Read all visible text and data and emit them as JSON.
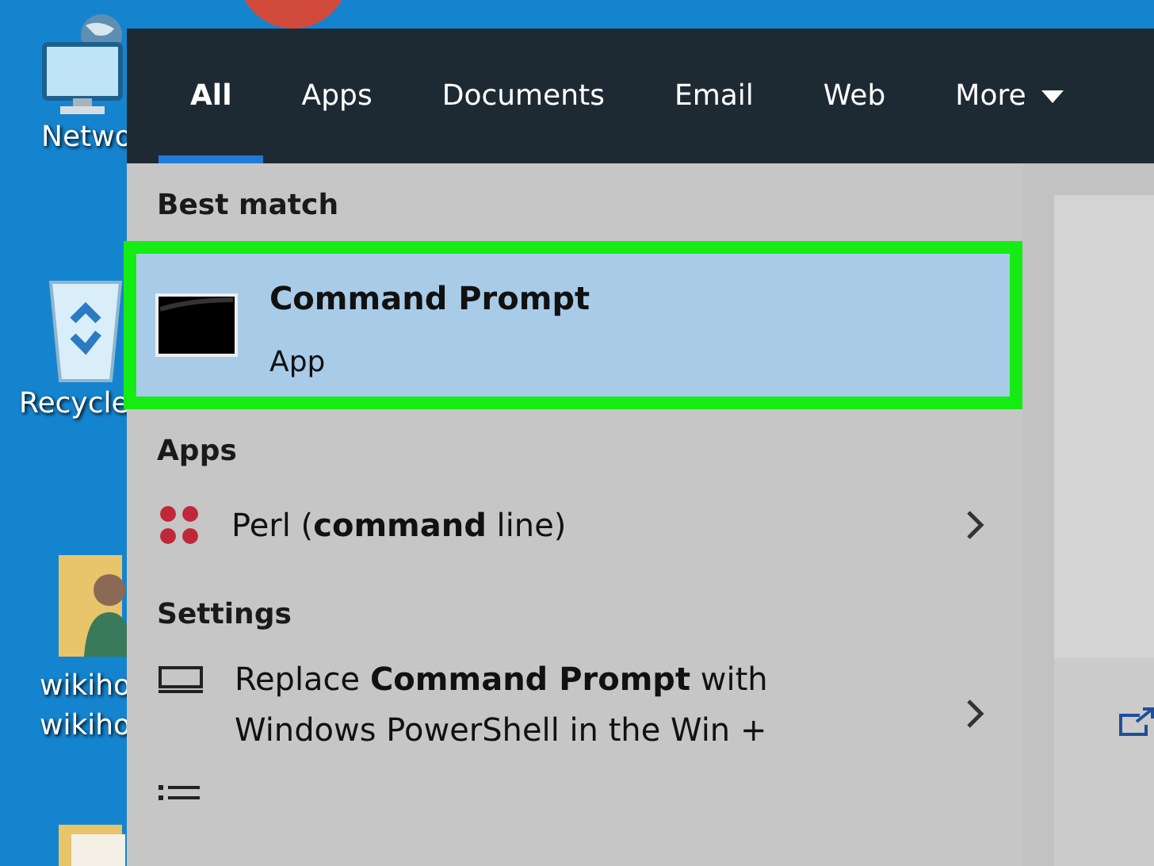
{
  "desktop": {
    "icons": [
      {
        "kind": "network",
        "lines": [
          "Netwo"
        ]
      },
      {
        "kind": "recycle",
        "lines": [
          "Recycle"
        ]
      },
      {
        "kind": "user-folder",
        "lines": [
          "wikiho",
          "wikiho"
        ]
      },
      {
        "kind": "folder"
      },
      {
        "kind": "red-ball"
      }
    ]
  },
  "search": {
    "tabs": [
      {
        "label": "All",
        "selected": true
      },
      {
        "label": "Apps",
        "selected": false
      },
      {
        "label": "Documents",
        "selected": false
      },
      {
        "label": "Email",
        "selected": false
      },
      {
        "label": "Web",
        "selected": false
      },
      {
        "label": "More",
        "selected": false,
        "dropdown": true
      }
    ],
    "sections": [
      {
        "header": "Best match",
        "results": [
          {
            "kind": "command-prompt",
            "title": "Command Prompt",
            "subtitle": "App",
            "selected": true,
            "highlighted": true
          }
        ]
      },
      {
        "header": "Apps",
        "results": [
          {
            "kind": "perl",
            "title": "Perl (**command** line)",
            "chevron": true,
            "selected": false
          }
        ]
      },
      {
        "header": "Settings",
        "results": [
          {
            "kind": "display",
            "title": "Replace **Command Prompt** with Windows PowerShell in the Win +",
            "chevron": true,
            "selected": false
          },
          {
            "kind": "list",
            "selected": false
          }
        ]
      }
    ]
  }
}
